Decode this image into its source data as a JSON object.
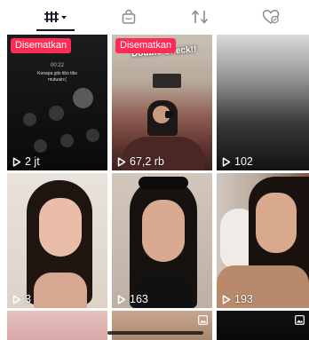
{
  "tabs": [
    {
      "name": "videos",
      "icon": "grid-icon",
      "active": true
    },
    {
      "name": "private",
      "icon": "lock-bag-icon",
      "active": false
    },
    {
      "name": "reposts",
      "icon": "repost-arrows-icon",
      "active": false
    },
    {
      "name": "liked",
      "icon": "heart-hidden-icon",
      "active": false
    }
  ],
  "grid": {
    "items": [
      {
        "pinned_label": "Disematkan",
        "plays": "2 jt"
      },
      {
        "pinned_label": "Disematkan",
        "plays": "67,2 rb",
        "headline": "Double Check!!"
      },
      {
        "plays": "102"
      },
      {
        "plays": "3"
      },
      {
        "plays": "163"
      },
      {
        "plays": "193"
      }
    ]
  },
  "tile1": {
    "time": "00:22",
    "caller": "Kenapa gits tibs tibs mutuain:(",
    "buttons": [
      "mute",
      "keypad",
      "speaker",
      "add call",
      "FaceTime",
      "contacts"
    ]
  },
  "colors": {
    "pin_badge": "#fe2c55",
    "active_tab_underline": "#161823",
    "icon_gray": "#8a8b91"
  }
}
